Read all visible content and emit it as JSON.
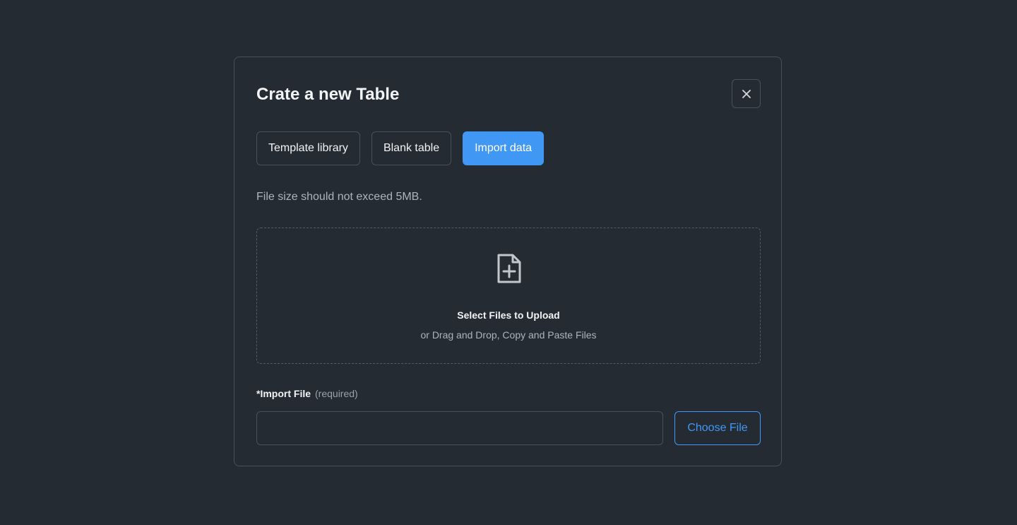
{
  "modal": {
    "title": "Crate a new Table",
    "close_icon": "close-icon"
  },
  "tabs": [
    {
      "label": "Template library",
      "active": false
    },
    {
      "label": "Blank table",
      "active": false
    },
    {
      "label": "Import data",
      "active": true
    }
  ],
  "hint": "File size should not exceed 5MB.",
  "dropzone": {
    "icon": "file-plus-icon",
    "title": "Select Files to Upload",
    "subtitle": "or Drag and Drop, Copy and Paste Files"
  },
  "import_field": {
    "label": "*Import File",
    "required_text": "(required)",
    "value": "",
    "button_label": "Choose File"
  },
  "colors": {
    "background": "#252b33",
    "accent": "#4198f4",
    "border": "#4a5058"
  }
}
